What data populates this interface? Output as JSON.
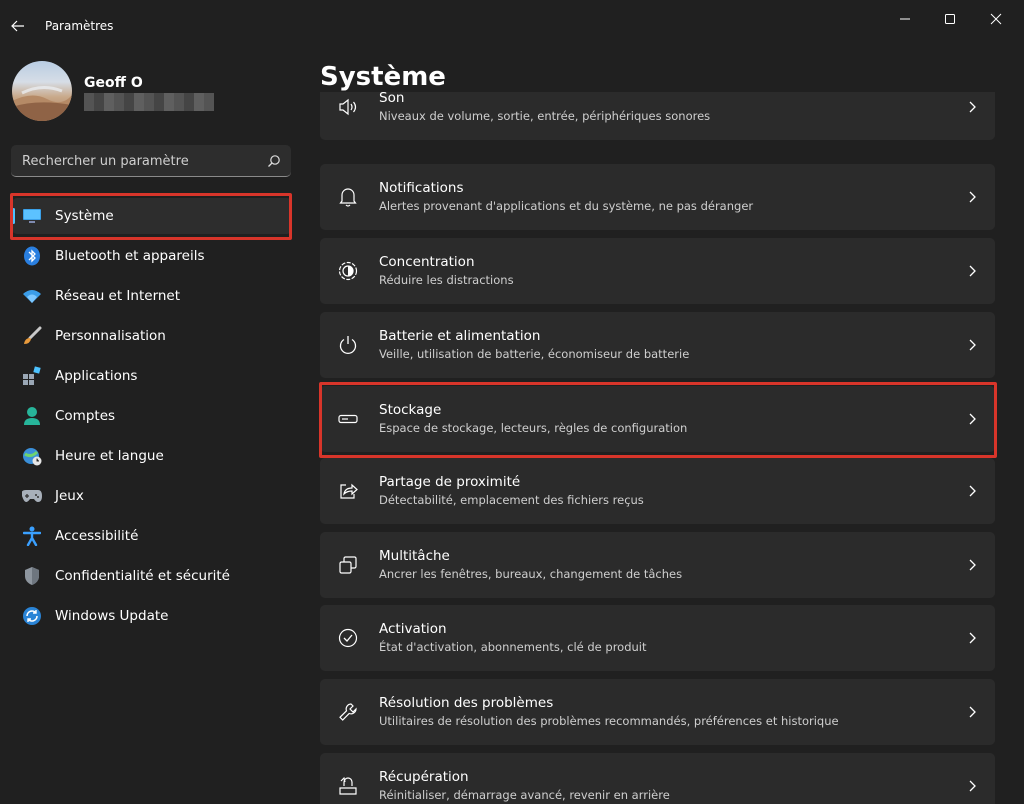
{
  "window": {
    "title": "Paramètres"
  },
  "profile": {
    "name": "Geoff O"
  },
  "search": {
    "placeholder": "Rechercher un paramètre"
  },
  "sidebar": {
    "items": [
      {
        "label": "Système",
        "icon": "display-icon",
        "selected": true
      },
      {
        "label": "Bluetooth et appareils",
        "icon": "bluetooth-icon"
      },
      {
        "label": "Réseau et Internet",
        "icon": "wifi-icon"
      },
      {
        "label": "Personnalisation",
        "icon": "paintbrush-icon"
      },
      {
        "label": "Applications",
        "icon": "apps-icon"
      },
      {
        "label": "Comptes",
        "icon": "person-icon"
      },
      {
        "label": "Heure et langue",
        "icon": "globe-clock-icon"
      },
      {
        "label": "Jeux",
        "icon": "gamepad-icon"
      },
      {
        "label": "Accessibilité",
        "icon": "accessibility-icon"
      },
      {
        "label": "Confidentialité et sécurité",
        "icon": "shield-icon"
      },
      {
        "label": "Windows Update",
        "icon": "update-icon"
      }
    ]
  },
  "main": {
    "title": "Système",
    "cards": [
      {
        "title": "Son",
        "subtitle": "Niveaux de volume, sortie, entrée, périphériques sonores",
        "icon": "speaker-icon"
      },
      {
        "title": "Notifications",
        "subtitle": "Alertes provenant d'applications et du système, ne pas déranger",
        "icon": "bell-icon"
      },
      {
        "title": "Concentration",
        "subtitle": "Réduire les distractions",
        "icon": "focus-icon"
      },
      {
        "title": "Batterie et alimentation",
        "subtitle": "Veille, utilisation de batterie, économiseur de batterie",
        "icon": "power-icon"
      },
      {
        "title": "Stockage",
        "subtitle": "Espace de stockage, lecteurs, règles de configuration",
        "icon": "drive-icon"
      },
      {
        "title": "Partage de proximité",
        "subtitle": "Détectabilité, emplacement des fichiers reçus",
        "icon": "share-icon"
      },
      {
        "title": "Multitâche",
        "subtitle": "Ancrer les fenêtres, bureaux, changement de tâches",
        "icon": "multitask-icon"
      },
      {
        "title": "Activation",
        "subtitle": "État d'activation, abonnements, clé de produit",
        "icon": "check-circle-icon"
      },
      {
        "title": "Résolution des problèmes",
        "subtitle": "Utilitaires de résolution des problèmes recommandés, préférences et historique",
        "icon": "wrench-icon"
      },
      {
        "title": "Récupération",
        "subtitle": "Réinitialiser, démarrage avancé, revenir en arrière",
        "icon": "recovery-icon"
      }
    ]
  },
  "colors": {
    "accent": "#4cc2ff",
    "highlight": "#d8352a",
    "card": "#2b2b2b",
    "background": "#202020"
  }
}
